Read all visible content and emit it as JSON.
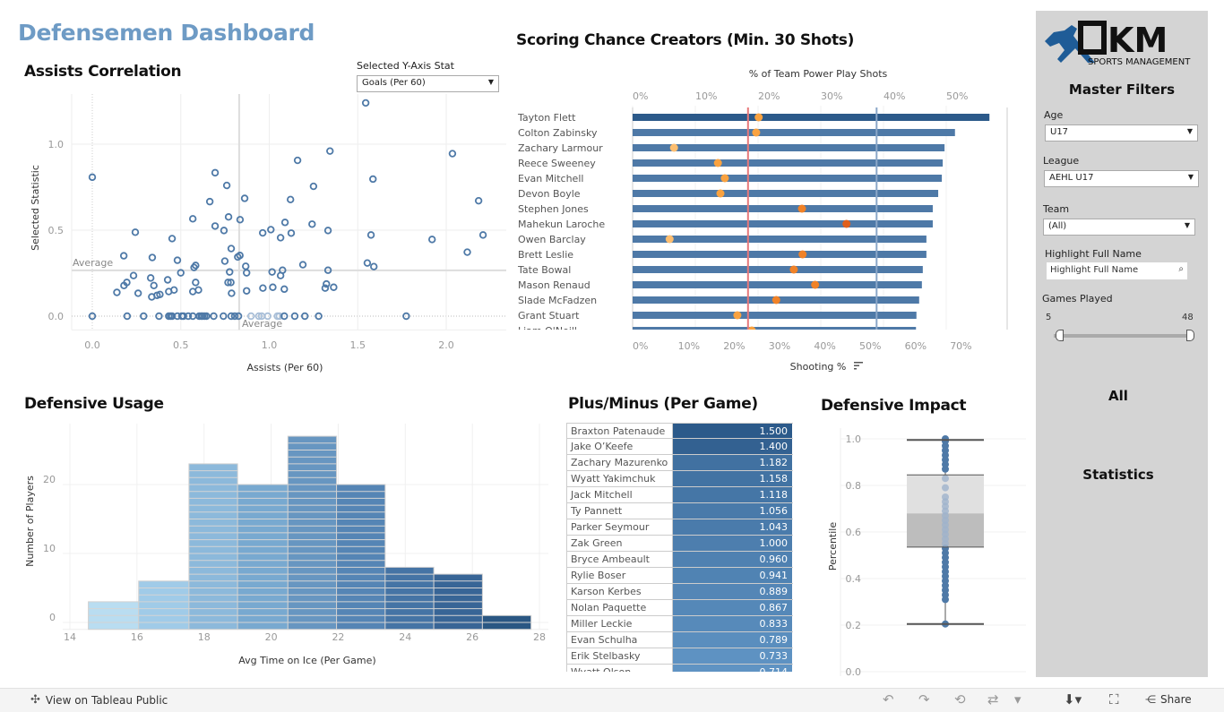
{
  "dashboard_title": "Defensemen Dashboard",
  "colors": {
    "title": "#6e9bc5",
    "mark_blue": "#4e79a7",
    "dark_blue": "#2a5783",
    "ref_red": "#e8787a",
    "ref_blue": "#8aa7c8",
    "dot_orange": "#f28e2b",
    "sidebar_bg": "#d4d4d4"
  },
  "assists_correlation": {
    "title": "Assists Correlation",
    "y_stat_label": "Selected Y-Axis Stat",
    "y_stat_value": "Goals (Per 60)",
    "chart_data": {
      "type": "scatter",
      "xlabel": "Assists (Per 60)",
      "ylabel": "Selected Statistic",
      "x_ticks": [
        "0.0",
        "0.5",
        "1.0",
        "1.5",
        "2.0"
      ],
      "y_ticks": [
        "0.0",
        "0.5",
        "1.0"
      ],
      "xlim": [
        -0.12,
        2.3
      ],
      "ylim": [
        -0.08,
        1.3
      ],
      "reference_lines": {
        "x_average": 0.83,
        "y_average": 0.266,
        "label": "Average"
      },
      "points": [
        [
          1.545,
          1.24
        ],
        [
          1.343,
          0.96
        ],
        [
          2.035,
          0.945
        ],
        [
          1.16,
          0.906
        ],
        [
          0,
          0.808
        ],
        [
          0.694,
          0.834
        ],
        [
          1.586,
          0.797
        ],
        [
          0.76,
          0.76
        ],
        [
          1.25,
          0.755
        ],
        [
          0.861,
          0.685
        ],
        [
          0.664,
          0.666
        ],
        [
          2.183,
          0.671
        ],
        [
          1.12,
          0.678
        ],
        [
          0.568,
          0.566
        ],
        [
          0.77,
          0.577
        ],
        [
          0.835,
          0.561
        ],
        [
          0.694,
          0.524
        ],
        [
          1.089,
          0.545
        ],
        [
          1.242,
          0.535
        ],
        [
          0.243,
          0.488
        ],
        [
          0.744,
          0.498
        ],
        [
          0.963,
          0.484
        ],
        [
          1.009,
          0.503
        ],
        [
          1.064,
          0.456
        ],
        [
          1.124,
          0.483
        ],
        [
          1.332,
          0.498
        ],
        [
          1.575,
          0.472
        ],
        [
          1.92,
          0.446
        ],
        [
          2.208,
          0.472
        ],
        [
          0.451,
          0.451
        ],
        [
          2.119,
          0.372
        ],
        [
          0.785,
          0.393
        ],
        [
          0.822,
          0.344
        ],
        [
          0.834,
          0.353
        ],
        [
          0.178,
          0.351
        ],
        [
          0.339,
          0.341
        ],
        [
          0.481,
          0.325
        ],
        [
          0.749,
          0.32
        ],
        [
          0.575,
          0.283
        ],
        [
          0.584,
          0.295
        ],
        [
          0.867,
          0.29
        ],
        [
          1.19,
          0.299
        ],
        [
          1.554,
          0.309
        ],
        [
          1.591,
          0.288
        ],
        [
          0.5,
          0.252
        ],
        [
          0.776,
          0.257
        ],
        [
          0.872,
          0.252
        ],
        [
          1.016,
          0.257
        ],
        [
          1.075,
          0.267
        ],
        [
          1.064,
          0.236
        ],
        [
          1.332,
          0.267
        ],
        [
          0.233,
          0.236
        ],
        [
          0.33,
          0.222
        ],
        [
          0.426,
          0.211
        ],
        [
          0.195,
          0.196
        ],
        [
          0.179,
          0.178
        ],
        [
          0.348,
          0.178
        ],
        [
          0.584,
          0.196
        ],
        [
          0.767,
          0.196
        ],
        [
          0.783,
          0.196
        ],
        [
          1.323,
          0.187
        ],
        [
          1.316,
          0.163
        ],
        [
          1.364,
          0.168
        ],
        [
          0.964,
          0.163
        ],
        [
          1.02,
          0.168
        ],
        [
          1.085,
          0.157
        ],
        [
          0.139,
          0.138
        ],
        [
          0.259,
          0.133
        ],
        [
          0.336,
          0.112
        ],
        [
          0.366,
          0.121
        ],
        [
          0.382,
          0.126
        ],
        [
          0.432,
          0.143
        ],
        [
          0.462,
          0.152
        ],
        [
          0.568,
          0.143
        ],
        [
          0.6,
          0.152
        ],
        [
          0.787,
          0.133
        ],
        [
          0.872,
          0.147
        ],
        [
          0,
          0
        ],
        [
          0.197,
          0
        ],
        [
          0.29,
          0
        ],
        [
          0.377,
          0
        ],
        [
          0.432,
          0
        ],
        [
          0.442,
          0
        ],
        [
          0.451,
          0
        ],
        [
          0.481,
          0
        ],
        [
          0.506,
          0
        ],
        [
          0.515,
          0
        ],
        [
          0.542,
          0
        ],
        [
          0.568,
          0
        ],
        [
          0.604,
          0
        ],
        [
          0.615,
          0
        ],
        [
          0.623,
          0
        ],
        [
          0.634,
          0
        ],
        [
          0.645,
          0
        ],
        [
          0.686,
          0
        ],
        [
          0.741,
          0
        ],
        [
          0.785,
          0
        ],
        [
          0.805,
          0
        ],
        [
          0.826,
          0
        ],
        [
          1.085,
          0
        ],
        [
          1.144,
          0
        ],
        [
          1.201,
          0
        ],
        [
          1.279,
          0
        ],
        [
          1.774,
          0
        ]
      ],
      "faded_points": [
        [
          0.897,
          0
        ],
        [
          0.941,
          0
        ],
        [
          0.957,
          0
        ],
        [
          0.991,
          0
        ],
        [
          1.046,
          0
        ],
        [
          1.057,
          0
        ]
      ]
    }
  },
  "scoring_chance": {
    "title": "Scoring Chance Creators (Min. 30 Shots)",
    "chart_data": {
      "type": "bar",
      "top_axis_label": "% of Team Power Play Shots",
      "top_ticks": [
        "0%",
        "10%",
        "20%",
        "30%",
        "40%",
        "50%"
      ],
      "bottom_axis_label": "Shooting %",
      "bottom_ticks": [
        "0%",
        "10%",
        "20%",
        "30%",
        "40%",
        "50%",
        "60%",
        "70%"
      ],
      "sort_icon": "sort-descending-icon",
      "categories": [
        "Tayton Flett",
        "Colton Zabinsky",
        "Zachary Larmour",
        "Reece Sweeney",
        "Evan Mitchell",
        "Devon Boyle",
        "Stephen Jones",
        "Mahekun Laroche",
        "Owen Barclay",
        "Brett Leslie",
        "Tate Bowal",
        "Mason Renaud",
        "Slade McFadzen",
        "Grant Stuart",
        "Liam O'Neill"
      ],
      "bar_values_shooting_pct": [
        78.7,
        71.1,
        68.8,
        68.4,
        68.2,
        67.4,
        66.2,
        66.2,
        64.8,
        64.8,
        64.0,
        63.8,
        63.2,
        62.6,
        62.5
      ],
      "dot_values_pp_shot_pct": [
        20.1,
        19.7,
        6.6,
        13.6,
        14.7,
        14.0,
        27.0,
        34.1,
        5.9,
        27.1,
        25.7,
        29.1,
        22.9,
        16.7,
        19.0
      ],
      "reference_lines_pp_shot_pct": {
        "red": 18.4,
        "blue": 38.9
      }
    }
  },
  "defensive_usage": {
    "title": "Defensive Usage",
    "chart_data": {
      "type": "bar",
      "xlabel": "Avg Time on Ice (Per Game)",
      "ylabel": "Number of Players",
      "x_ticks": [
        "14",
        "16",
        "18",
        "20",
        "22",
        "24",
        "26",
        "28"
      ],
      "y_ticks": [
        "0",
        "10",
        "20"
      ],
      "bin_edges": [
        14.55,
        16.05,
        17.55,
        19.0,
        20.5,
        21.95,
        23.4,
        24.85,
        26.3,
        27.75
      ],
      "values": [
        3,
        6,
        23,
        20,
        27,
        20,
        8,
        7,
        1
      ]
    }
  },
  "plus_minus": {
    "title": "Plus/Minus (Per Game)",
    "rows": [
      {
        "name": "Braxton Patenaude",
        "value": "1.500"
      },
      {
        "name": "Jake O’Keefe",
        "value": "1.400"
      },
      {
        "name": "Zachary Mazurenko",
        "value": "1.182"
      },
      {
        "name": "Wyatt Yakimchuk",
        "value": "1.158"
      },
      {
        "name": "Jack Mitchell",
        "value": "1.118"
      },
      {
        "name": "Ty Pannett",
        "value": "1.056"
      },
      {
        "name": "Parker Seymour",
        "value": "1.043"
      },
      {
        "name": "Zak Green",
        "value": "1.000"
      },
      {
        "name": "Bryce Ambeault",
        "value": "0.960"
      },
      {
        "name": "Rylie Boser",
        "value": "0.941"
      },
      {
        "name": "Karson Kerbes",
        "value": "0.889"
      },
      {
        "name": "Nolan Paquette",
        "value": "0.867"
      },
      {
        "name": "Miller Leckie",
        "value": "0.833"
      },
      {
        "name": "Evan Schulha",
        "value": "0.789"
      },
      {
        "name": "Erik Stelbasky",
        "value": "0.733"
      },
      {
        "name": "Wyatt Olson",
        "value": "0.714"
      }
    ]
  },
  "defensive_impact": {
    "title": "Defensive Impact",
    "chart_data": {
      "type": "box",
      "ylabel": "Percentile",
      "y_ticks": [
        "0.0",
        "0.2",
        "0.4",
        "0.6",
        "0.8",
        "1.0"
      ],
      "whisker_low": 0.205,
      "q1": 0.535,
      "median": 0.68,
      "q3": 0.845,
      "whisker_high": 0.995,
      "points": [
        0.205,
        0.31,
        0.33,
        0.35,
        0.37,
        0.39,
        0.41,
        0.43,
        0.45,
        0.47,
        0.49,
        0.51,
        0.53,
        0.55,
        0.57,
        0.59,
        0.61,
        0.63,
        0.65,
        0.67,
        0.69,
        0.71,
        0.73,
        0.75,
        0.79,
        0.83,
        0.87,
        0.89,
        0.91,
        0.93,
        0.95,
        0.97,
        0.99,
        1.0
      ]
    }
  },
  "sidebar": {
    "logo_text": "CKM",
    "logo_sub": "SPORTS MANAGEMENT",
    "title": "Master Filters",
    "age_label": "Age",
    "age_value": "U17",
    "league_label": "League",
    "league_value": "AEHL U17",
    "team_label": "Team",
    "team_value": "(All)",
    "highlight_label": "Highlight Full Name",
    "highlight_placeholder": "Highlight Full Name",
    "games_label": "Games Played",
    "games_min": "5",
    "games_max": "48",
    "all_text": "All",
    "statistics_text": "Statistics"
  },
  "toolbar": {
    "view_label": "View on Tableau Public",
    "share_label": "Share"
  }
}
